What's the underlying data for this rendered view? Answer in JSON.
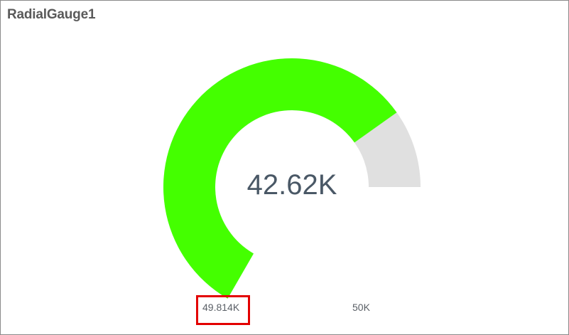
{
  "widget": {
    "title": "RadialGauge1"
  },
  "chart_data": {
    "type": "radial-gauge",
    "title": "RadialGauge1",
    "value": 42620,
    "value_label": "42.62K",
    "min": 0,
    "max": 50000,
    "min_label": "49.814K",
    "max_label": "50K",
    "colors": {
      "fill": "#44ff00",
      "track": "#e0e0e0",
      "value_text": "#4a5866",
      "highlight": "#e30000"
    }
  }
}
